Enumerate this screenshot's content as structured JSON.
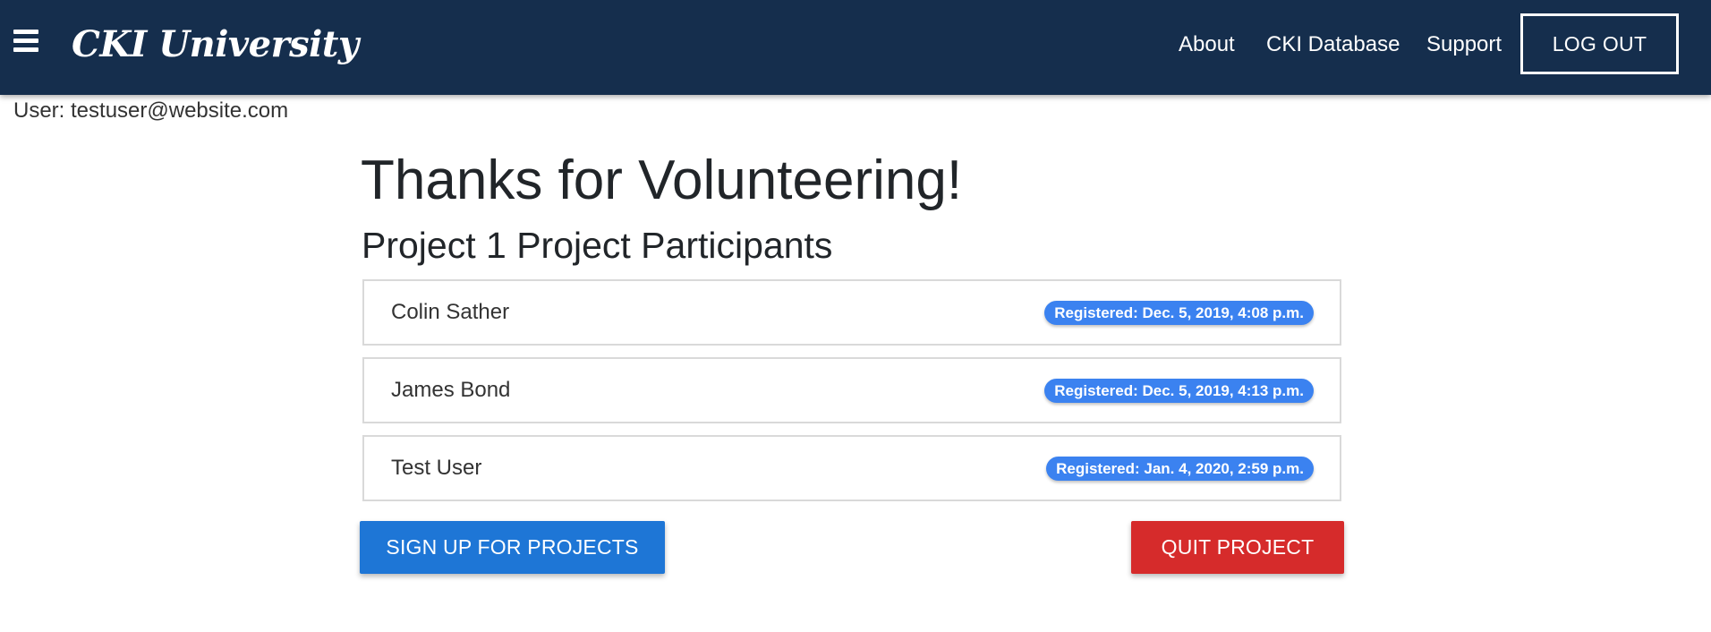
{
  "header": {
    "brand": "CKI University",
    "nav_links": [
      "About",
      "CKI Database",
      "Support"
    ],
    "logout_label": "LOG OUT"
  },
  "user": {
    "label": "User: testuser@website.com"
  },
  "main": {
    "title": "Thanks for Volunteering!",
    "subtitle": "Project 1 Project Participants",
    "participants": [
      {
        "name": "Colin Sather",
        "registered": "Registered: Dec. 5, 2019, 4:08 p.m."
      },
      {
        "name": "James Bond",
        "registered": "Registered: Dec. 5, 2019, 4:13 p.m."
      },
      {
        "name": "Test User",
        "registered": "Registered: Jan. 4, 2020, 2:59 p.m."
      }
    ],
    "signup_label": "SIGN UP FOR PROJECTS",
    "quit_label": "QUIT PROJECT"
  },
  "icons": {
    "menu": "hamburger-menu-icon"
  },
  "colors": {
    "navbar": "#152e4d",
    "badge": "#3b82f0",
    "signup_button": "#1e76d6",
    "quit_button": "#d62b2b"
  }
}
